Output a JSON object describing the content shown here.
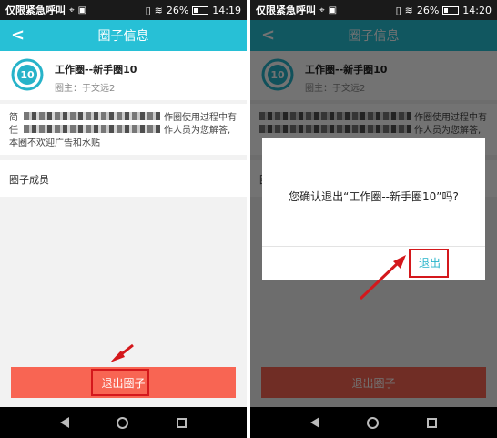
{
  "status_left": {
    "carrier": "仅限紧急呼叫",
    "battery": "26%",
    "time": "14:19",
    "icons": [
      "location-icon",
      "image-icon",
      "sim-icon",
      "wifi-icon",
      "battery-icon"
    ]
  },
  "status_right": {
    "carrier": "仅限紧急呼叫",
    "battery": "26%",
    "time": "14:20"
  },
  "header": {
    "title": "圈子信息",
    "back_icon": "chevron-left-icon"
  },
  "circle": {
    "logo_number": "10",
    "name": "工作圈--新手圈10",
    "owner": "圈主：于文远2"
  },
  "description": {
    "line1_start": "简",
    "line1_end": "作圈使用过程中有",
    "line2_start": "任",
    "line2_end": "作人员为您解答,",
    "line3": "本圈不欢迎广告和水贴"
  },
  "members": {
    "label": "圈子成员"
  },
  "quit_button": {
    "label": "退出圈子"
  },
  "dialog": {
    "message": "您确认退出“工作圈--新手圈10”吗?",
    "confirm_label": "退出"
  },
  "colors": {
    "teal": "#27c0d6",
    "quit_red": "#f86553",
    "highlight_red": "#d4181c"
  }
}
